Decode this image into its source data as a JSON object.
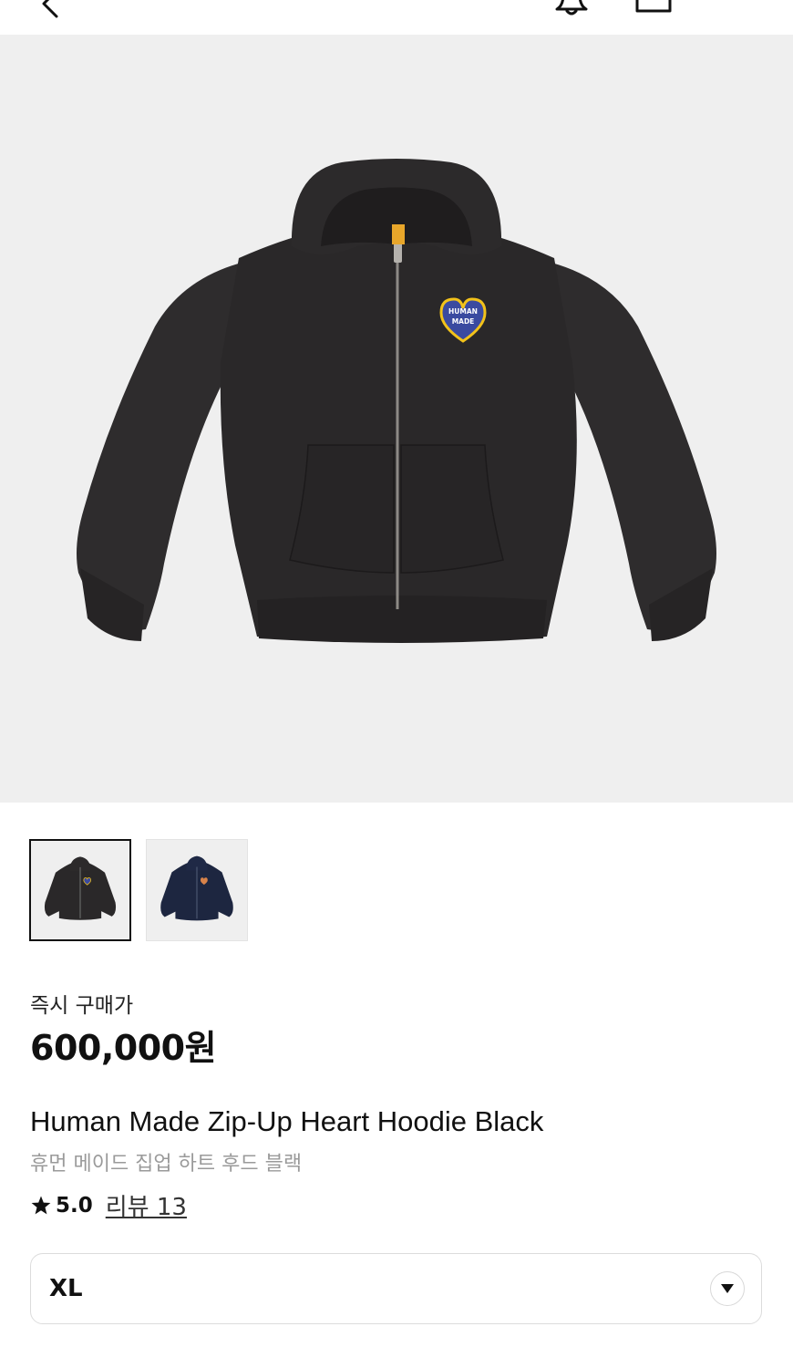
{
  "icons": {
    "back": "chevron-left-icon",
    "notification": "bell-icon",
    "bag": "shopping-bag-icon",
    "star": "star-icon",
    "dropdown": "chevron-down-icon"
  },
  "colors": {
    "hoodie_black": "#2a2829",
    "hoodie_navy": "#1d2640",
    "logo_blue": "#3a4aa0",
    "logo_yellow": "#f2c21a",
    "image_bg": "#efefef"
  },
  "product": {
    "price_label": "즉시 구매가",
    "price": "600,000원",
    "name_en": "Human Made Zip-Up Heart Hoodie Black",
    "name_ko": "휴먼 메이드 집업 하트 후드 블랙",
    "rating": "5.0",
    "reviews": "리뷰 13",
    "logo_text_line1": "HUMAN",
    "logo_text_line2": "MADE"
  },
  "thumbnails": [
    {
      "color": "black",
      "selected": true
    },
    {
      "color": "navy",
      "selected": false
    }
  ],
  "size_select": {
    "value": "XL"
  }
}
